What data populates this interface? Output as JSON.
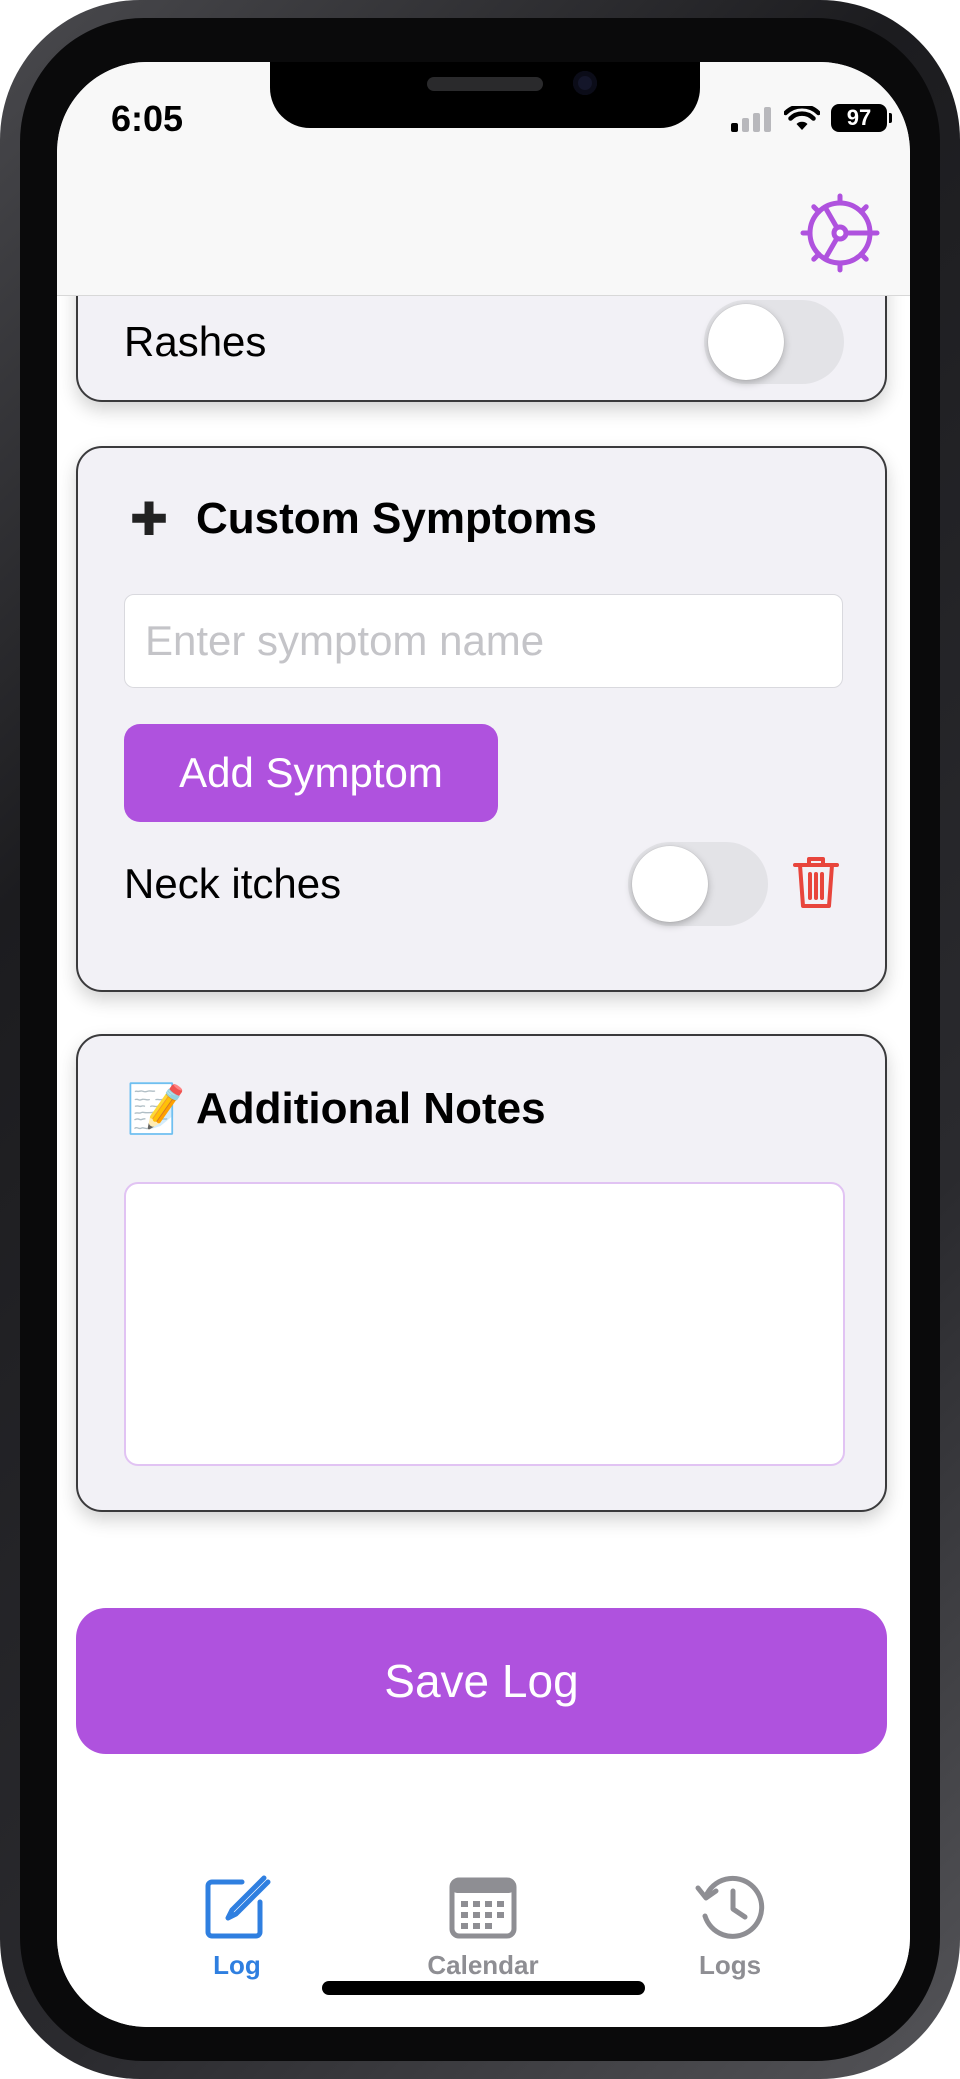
{
  "colors": {
    "accent": "#af52de",
    "tab_active": "#2f7fe0",
    "tab_inactive": "#8e8e93",
    "delete": "#e8453c"
  },
  "status_bar": {
    "time": "6:05",
    "battery": "97",
    "signal_bars_active": 1
  },
  "nav": {
    "settings_icon": "gear-icon"
  },
  "rashes_card": {
    "label": "Rashes",
    "toggle_on": false
  },
  "custom_symptoms": {
    "icon": "plus-icon",
    "icon_glyph": "✚",
    "title": "Custom Symptoms",
    "input_value": "",
    "input_placeholder": "Enter symptom name",
    "add_button_label": "Add Symptom",
    "items": [
      {
        "label": "Neck itches",
        "toggle_on": false,
        "delete_icon": "trash-icon"
      }
    ]
  },
  "notes": {
    "icon": "memo-icon",
    "icon_glyph": "📝",
    "title": "Additional Notes",
    "value": ""
  },
  "save_button_label": "Save Log",
  "tabs": [
    {
      "label": "Log",
      "icon": "edit-square-icon",
      "active": true
    },
    {
      "label": "Calendar",
      "icon": "calendar-icon",
      "active": false
    },
    {
      "label": "Logs",
      "icon": "history-icon",
      "active": false
    }
  ]
}
